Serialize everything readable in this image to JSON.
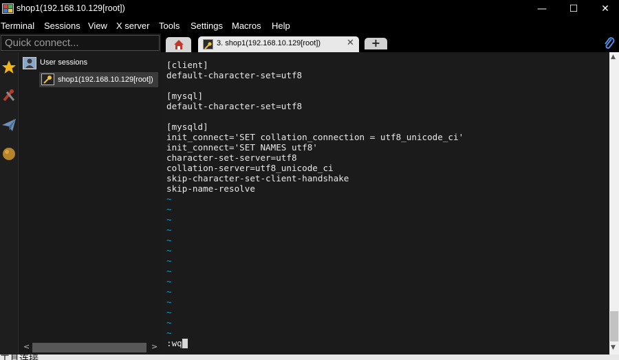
{
  "window": {
    "title": "shop1(192.168.10.129[root])",
    "minimize": "—",
    "maximize": "☐",
    "close": "✕"
  },
  "menu": [
    "Terminal",
    "Sessions",
    "View",
    "X server",
    "Tools",
    "Settings",
    "Macros",
    "Help"
  ],
  "quick_connect": {
    "placeholder": "Quick connect..."
  },
  "tabs": {
    "active_label": "3. shop1(192.168.10.129[root])",
    "close": "✕",
    "new_tab": "+"
  },
  "sessions": {
    "group_label": "User sessions",
    "items": [
      {
        "label": "shop1(192.168.10.129[root])"
      }
    ],
    "scroll_left": "<",
    "scroll_right": ">"
  },
  "terminal": {
    "lines": [
      "[client]",
      "default-character-set=utf8",
      "",
      "[mysql]",
      "default-character-set=utf8",
      "",
      "[mysqld]",
      "init_connect='SET collation_connection = utf8_unicode_ci'",
      "init_connect='SET NAMES utf8'",
      "character-set-server=utf8",
      "collation-server=utf8_unicode_ci",
      "skip-character-set-client-handshake",
      "skip-name-resolve"
    ],
    "tilde": "~",
    "tilde_count": 14,
    "command": ":wq"
  },
  "scrollbar": {
    "up": "▲",
    "down": "▼"
  },
  "bottom_text": "工具连接",
  "colors": {
    "accent_tilde": "#00a5d5",
    "terminal_bg": "#1b1b1b",
    "titlebar_bg": "#000000"
  },
  "icons": [
    "mobaxterm-app-icon",
    "home-icon",
    "key-icon",
    "plus-icon",
    "paperclip-icon",
    "star-icon",
    "tools-icon",
    "send-icon",
    "globe-icon",
    "user-sessions-icon"
  ]
}
